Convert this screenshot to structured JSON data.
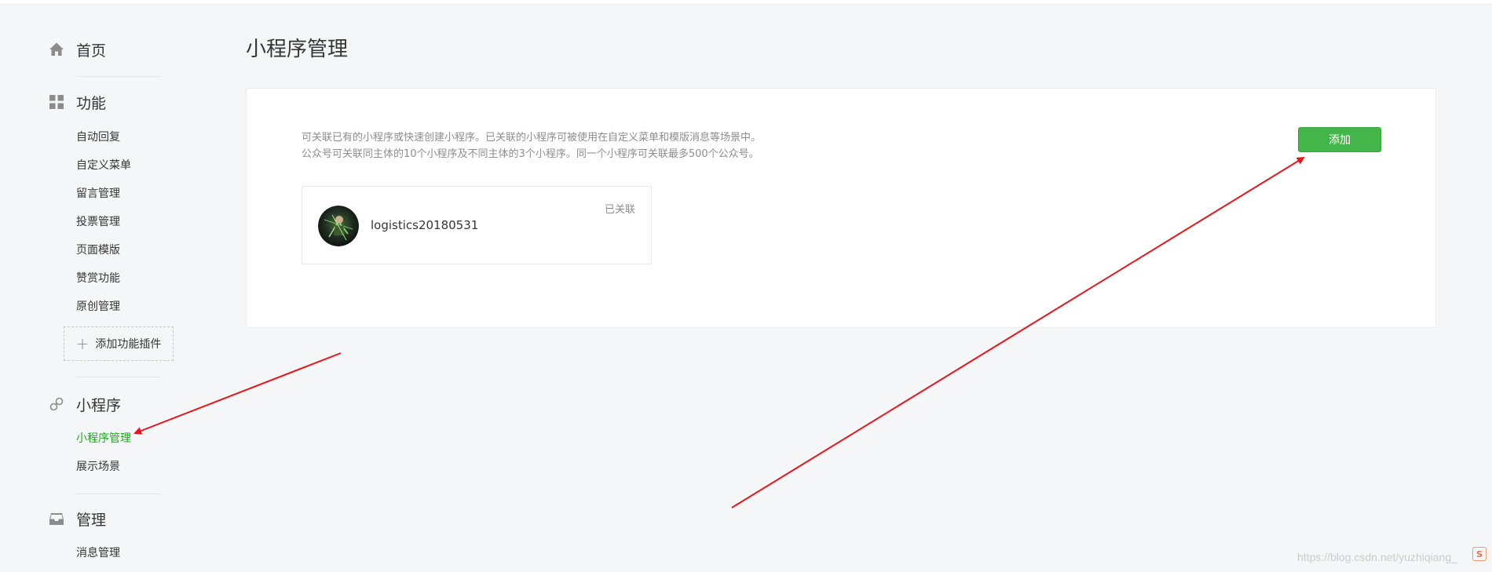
{
  "sidebar": {
    "sections": {
      "home": {
        "title": "首页",
        "icon": "home-icon"
      },
      "features": {
        "title": "功能",
        "icon": "grid-icon",
        "items": [
          "自动回复",
          "自定义菜单",
          "留言管理",
          "投票管理",
          "页面模版",
          "赞赏功能",
          "原创管理"
        ],
        "add_plugin_label": "添加功能插件"
      },
      "miniprogram": {
        "title": "小程序",
        "icon": "link-icon",
        "items": [
          "小程序管理",
          "展示场景"
        ]
      },
      "manage": {
        "title": "管理",
        "icon": "inbox-icon",
        "items": [
          "消息管理"
        ]
      }
    },
    "active_color": "#1aad19"
  },
  "main": {
    "title": "小程序管理",
    "description": [
      "可关联已有的小程序或快速创建小程序。已关联的小程序可被使用在自定义菜单和模版消息等场景中。",
      "公众号可关联同主体的10个小程序及不同主体的3个小程序。同一个小程序可关联最多500个公众号。"
    ],
    "add_button": "添加",
    "add_button_color": "#44b549",
    "miniprograms": [
      {
        "name": "logistics20180531",
        "status": "已关联"
      }
    ]
  },
  "watermark": "https://blog.csdn.net/yuzhiqiang_",
  "badge": "S"
}
